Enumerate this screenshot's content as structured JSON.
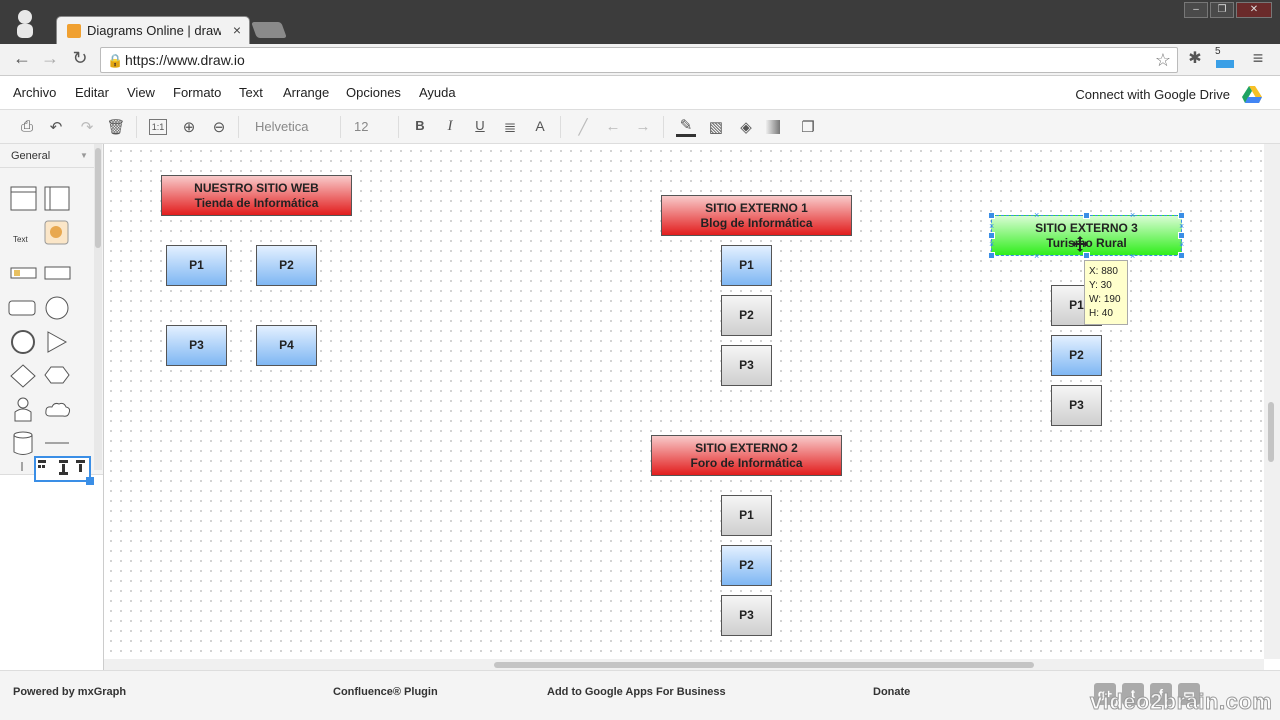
{
  "browser": {
    "tab_title": "Diagrams Online | draw.io",
    "tab_close": "×",
    "url": "https://www.draw.io",
    "window_buttons": [
      "–",
      "❐",
      "✕"
    ],
    "ext_badge": "5"
  },
  "menu": {
    "items": [
      "Archivo",
      "Editar",
      "View",
      "Formato",
      "Text",
      "Arrange",
      "Opciones",
      "Ayuda"
    ],
    "connect_drive": "Connect with Google Drive"
  },
  "toolbar": {
    "font_name": "Helvetica",
    "font_size": "12"
  },
  "sidebar": {
    "title": "General",
    "text_shape_label": "Text"
  },
  "diagram": {
    "groups": [
      {
        "header": [
          "NUESTRO SITIO WEB",
          "Tienda de Informática"
        ],
        "pages": [
          "P1",
          "P2",
          "P3",
          "P4"
        ]
      },
      {
        "header": [
          "SITIO EXTERNO 1",
          "Blog de Informática"
        ],
        "pages": [
          "P1",
          "P2",
          "P3"
        ]
      },
      {
        "header": [
          "SITIO EXTERNO 2",
          "Foro de Informática"
        ],
        "pages": [
          "P1",
          "P2",
          "P3"
        ]
      },
      {
        "header": [
          "SITIO EXTERNO 3",
          "Turismo Rural"
        ],
        "pages": [
          "P1",
          "P2",
          "P3"
        ]
      }
    ],
    "selection_tooltip": [
      "X: 880",
      "Y: 30",
      "W: 190",
      "H: 40"
    ]
  },
  "footer": {
    "links": [
      "Powered by mxGraph",
      "Confluence® Plugin",
      "Add to Google Apps For Business",
      "Donate"
    ],
    "social": [
      "g+",
      "t",
      "f",
      "▭"
    ],
    "watermark": "video2brain.com"
  },
  "colors": {
    "header_red": "#e21d1d",
    "page_blue": "#7fb7f3",
    "selected_green": "#30ee1c",
    "selection_blue": "#3a8ee6"
  }
}
